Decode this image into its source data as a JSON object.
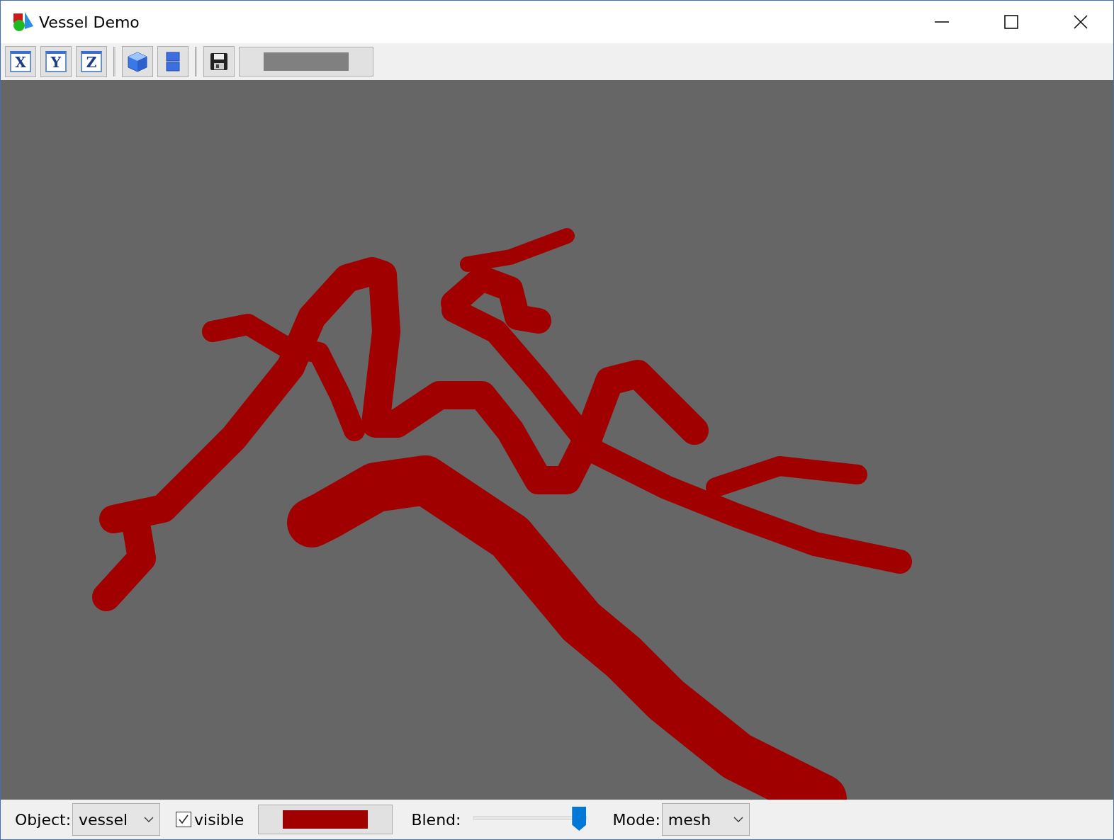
{
  "window": {
    "title": "Vessel Demo"
  },
  "toolbar": {
    "items": [
      {
        "kind": "axis",
        "label": "X"
      },
      {
        "kind": "axis",
        "label": "Y"
      },
      {
        "kind": "axis",
        "label": "Z"
      },
      {
        "kind": "separator"
      },
      {
        "kind": "cube"
      },
      {
        "kind": "split"
      },
      {
        "kind": "separator"
      },
      {
        "kind": "save"
      },
      {
        "kind": "color",
        "color": "#808080"
      }
    ]
  },
  "bottom_bar": {
    "object_label": "Object:",
    "object_value": "vessel",
    "visible": {
      "label": "visible",
      "checked": true
    },
    "color_button": {
      "color": "#a00000"
    },
    "blend_label": "Blend:",
    "blend": {
      "level": 0.93
    },
    "mode_label": "Mode:",
    "mode_value": "mesh"
  }
}
